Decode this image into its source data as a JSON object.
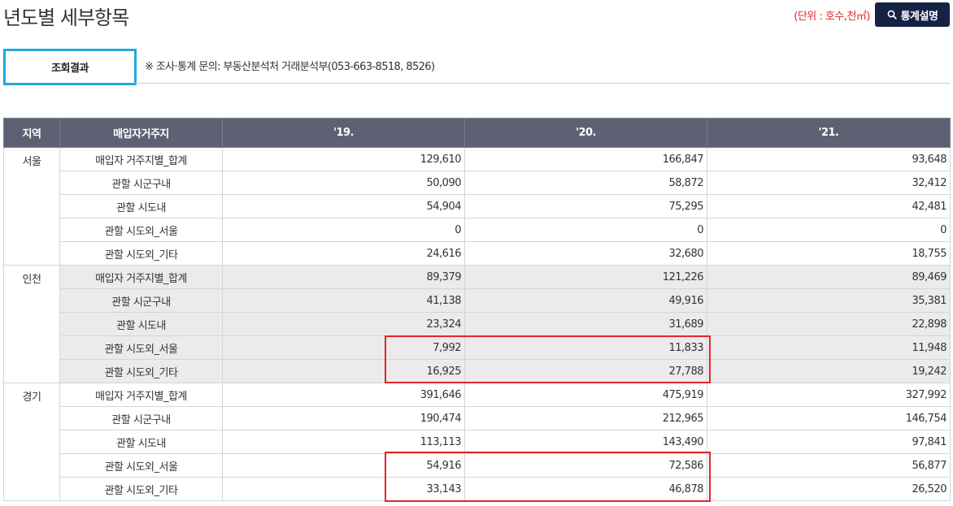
{
  "page": {
    "title": "년도별 세부항목",
    "unit_note": "(단위 : 호수,천㎡)",
    "stats_button_label": "통계설명",
    "result_tab_label": "조회결과",
    "inquiry_text": "※ 조사·통계 문의: 부동산분석처 거래분석부(053-663-8518, 8526)"
  },
  "colors": {
    "header_bg": "#5d6173",
    "button_bg": "#152245",
    "tab_border": "#23a7e0",
    "highlight": "#e3262c",
    "unit_note": "#e0262c"
  },
  "table": {
    "headers": [
      "지역",
      "매입자거주지",
      "'19.",
      "'20.",
      "'21."
    ],
    "groups": [
      {
        "region": "서울",
        "shaded": false,
        "rows": [
          {
            "item": "매입자 거주지별_합계",
            "values": [
              "129,610",
              "166,847",
              "93,648"
            ]
          },
          {
            "item": "관할 시군구내",
            "values": [
              "50,090",
              "58,872",
              "32,412"
            ]
          },
          {
            "item": "관할 시도내",
            "values": [
              "54,904",
              "75,295",
              "42,481"
            ]
          },
          {
            "item": "관할 시도외_서울",
            "values": [
              "0",
              "0",
              "0"
            ]
          },
          {
            "item": "관할 시도외_기타",
            "values": [
              "24,616",
              "32,680",
              "18,755"
            ]
          }
        ]
      },
      {
        "region": "인천",
        "shaded": true,
        "rows": [
          {
            "item": "매입자 거주지별_합계",
            "values": [
              "89,379",
              "121,226",
              "89,469"
            ]
          },
          {
            "item": "관할 시군구내",
            "values": [
              "41,138",
              "49,916",
              "35,381"
            ]
          },
          {
            "item": "관할 시도내",
            "values": [
              "23,324",
              "31,689",
              "22,898"
            ]
          },
          {
            "item": "관할 시도외_서울",
            "values": [
              "7,992",
              "11,833",
              "11,948"
            ]
          },
          {
            "item": "관할 시도외_기타",
            "values": [
              "16,925",
              "27,788",
              "19,242"
            ]
          }
        ]
      },
      {
        "region": "경기",
        "shaded": false,
        "rows": [
          {
            "item": "매입자 거주지별_합계",
            "values": [
              "391,646",
              "475,919",
              "327,992"
            ]
          },
          {
            "item": "관할 시군구내",
            "values": [
              "190,474",
              "212,965",
              "146,754"
            ]
          },
          {
            "item": "관할 시도내",
            "values": [
              "113,113",
              "143,490",
              "97,841"
            ]
          },
          {
            "item": "관할 시도외_서울",
            "values": [
              "54,916",
              "72,586",
              "56,877"
            ]
          },
          {
            "item": "관할 시도외_기타",
            "values": [
              "33,143",
              "46,878",
              "26,520"
            ]
          }
        ]
      }
    ]
  }
}
